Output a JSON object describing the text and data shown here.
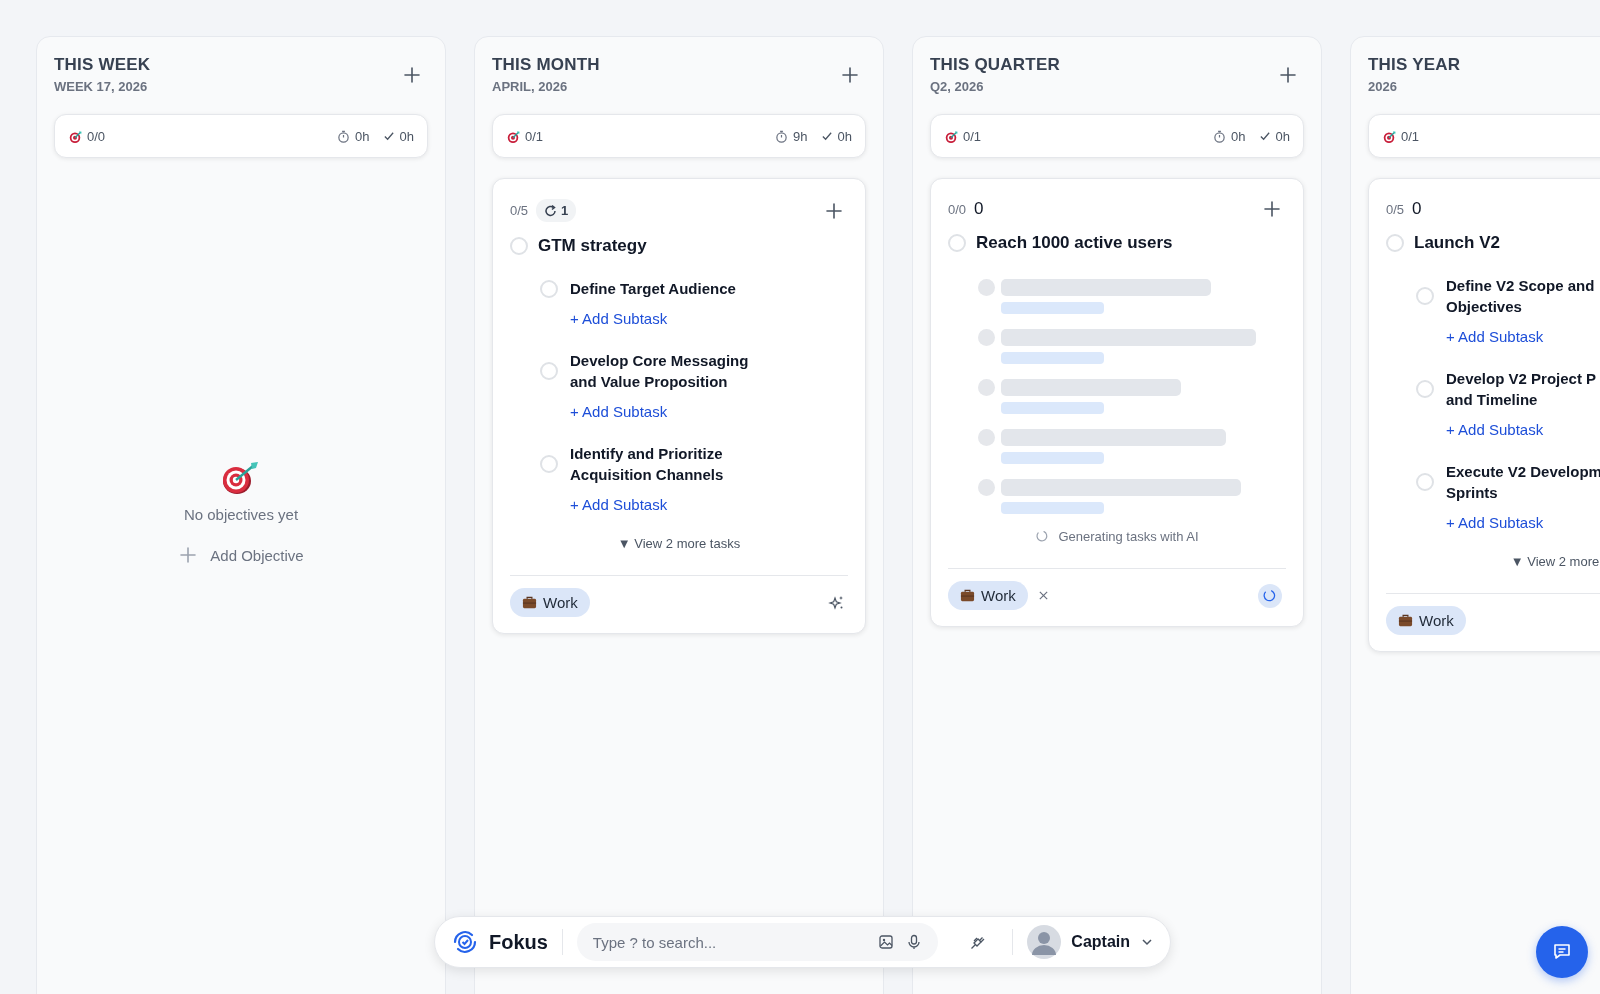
{
  "columns": [
    {
      "title": "THIS WEEK",
      "subtitle": "WEEK 17, 2026",
      "add_button": true,
      "stats": {
        "objectives": "0/0",
        "time": "0h",
        "done": "0h"
      },
      "empty": {
        "message": "No objectives yet",
        "action": "Add Objective"
      }
    },
    {
      "title": "THIS MONTH",
      "subtitle": "APRIL, 2026",
      "add_button": true,
      "stats": {
        "objectives": "0/1",
        "time": "9h",
        "done": "0h"
      },
      "objectives": [
        {
          "progress": "0/5",
          "add_button": true,
          "counter": {
            "kind": "streak",
            "value": "1"
          },
          "title": "GTM strategy",
          "checked": false,
          "tasks": [
            {
              "title": "Define Target Audience",
              "checked": false,
              "action": "+ Add Subtask"
            },
            {
              "title": "Develop Core Messaging\nand Value Proposition",
              "checked": false,
              "action": "+ Add Subtask"
            },
            {
              "title": "Identify and Prioritize\nAcquisition Channels",
              "checked": false,
              "action": "+ Add Subtask"
            }
          ],
          "more": "▼ View 2 more tasks",
          "tag": "Work",
          "busy": false
        }
      ]
    },
    {
      "title": "THIS QUARTER",
      "subtitle": "Q2, 2026",
      "add_button": true,
      "stats": {
        "objectives": "0/1",
        "time": "0h",
        "done": "0h"
      },
      "objectives": [
        {
          "progress": "0/0",
          "add_button": true,
          "counter": {
            "kind": "plain",
            "value": "0"
          },
          "title": "Reach 1000 active users",
          "checked": false,
          "status": "Generating tasks with AI",
          "tag": "Work",
          "removable": true,
          "busy": true
        }
      ]
    },
    {
      "title": "THIS YEAR",
      "subtitle": "2026",
      "stats": {
        "objectives": "0/1"
      },
      "objectives": [
        {
          "progress": "0/5",
          "counter": {
            "kind": "plain",
            "value": "0"
          },
          "title": "Launch V2",
          "checked": false,
          "tasks": [
            {
              "title": "Define V2 Scope and\nObjectives",
              "checked": false,
              "action": "+ Add Subtask"
            },
            {
              "title": "Develop V2 Project P\nand Timeline",
              "checked": false,
              "action": "+ Add Subtask"
            },
            {
              "title": "Execute V2 Developm\nSprints",
              "checked": false,
              "action": "+ Add Subtask"
            }
          ],
          "more": "▼ View 2 more",
          "tag": "Work"
        }
      ]
    }
  ],
  "dock": {
    "brand": "Fokus",
    "search": {
      "placeholder": "Type ? to search..."
    },
    "user": "Captain"
  }
}
